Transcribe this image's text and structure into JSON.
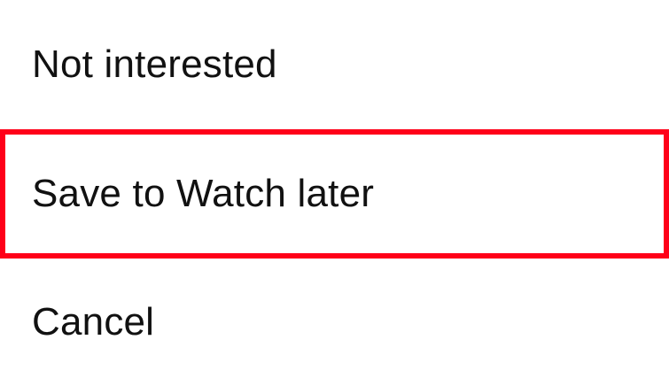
{
  "menu": {
    "items": [
      {
        "label": "Not interested"
      },
      {
        "label": "Save to Watch later"
      },
      {
        "label": "Cancel"
      }
    ]
  },
  "colors": {
    "highlight_border": "#ff0019",
    "text": "#111111",
    "background": "#ffffff"
  }
}
